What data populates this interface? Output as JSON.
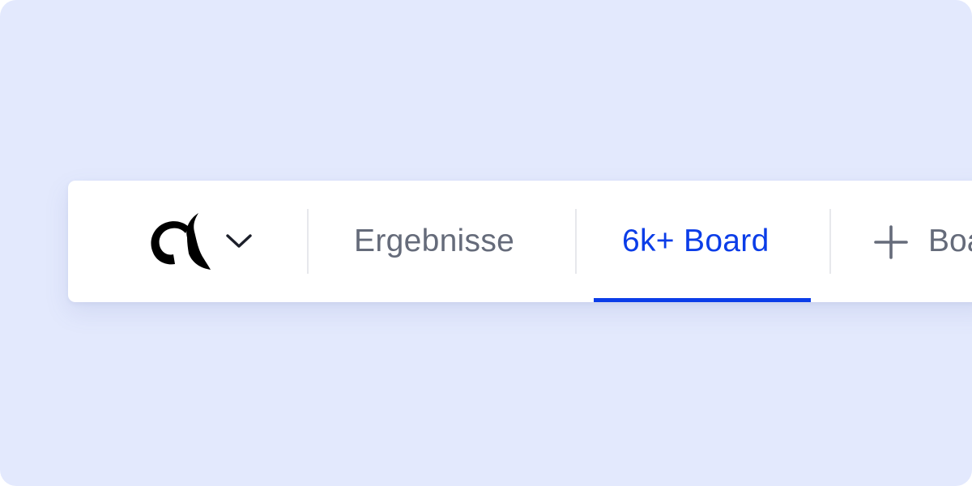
{
  "colors": {
    "background": "#e3e9fd",
    "bar": "#ffffff",
    "tab_text": "#656b7a",
    "active_tab": "#0b3de8",
    "divider": "#e7e8ec",
    "logo": "#000000"
  },
  "workspace_switcher": {
    "logo_icon": "logo-icon",
    "dropdown_icon": "chevron-down-icon"
  },
  "tabs": [
    {
      "label": "Ergebnisse",
      "active": false
    },
    {
      "label": "6k+ Board",
      "active": true
    }
  ],
  "add_board": {
    "icon": "plus-icon",
    "label": "Board"
  }
}
